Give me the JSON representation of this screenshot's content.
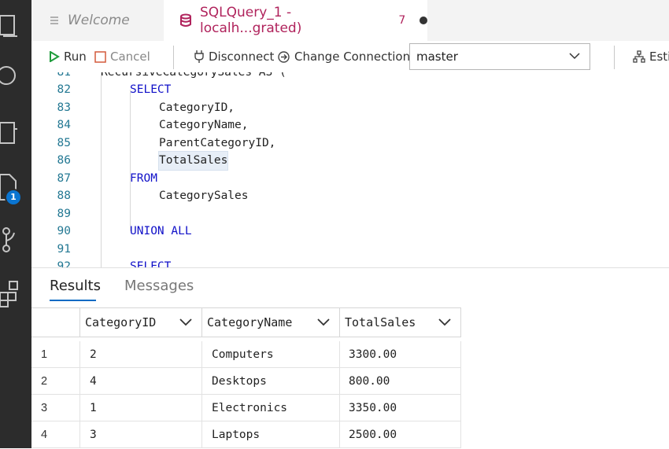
{
  "tabs": {
    "welcome": "Welcome",
    "query": {
      "title": "SQLQuery_1 - localh...grated)",
      "count": "7"
    }
  },
  "toolbar": {
    "run": "Run",
    "cancel": "Cancel",
    "disconnect": "Disconnect",
    "change_connection": "Change Connection",
    "database": "master",
    "estimate": "Esti"
  },
  "activity_bar": {
    "icons": [
      "explorer-icon",
      "search-icon",
      "notebooks-icon",
      "queries-icon",
      "source-control-icon",
      "extensions-icon"
    ],
    "badge": "1"
  },
  "editor": {
    "lines": [
      {
        "num": "81",
        "text": "RecursiveCategorySales AS ("
      },
      {
        "num": "82",
        "text": "SELECT"
      },
      {
        "num": "83",
        "text": "CategoryID,"
      },
      {
        "num": "84",
        "text": "CategoryName,"
      },
      {
        "num": "85",
        "text": "ParentCategoryID,"
      },
      {
        "num": "86",
        "text": "TotalSales"
      },
      {
        "num": "87",
        "text": "FROM"
      },
      {
        "num": "88",
        "text": "CategorySales"
      },
      {
        "num": "89",
        "text": ""
      },
      {
        "num": "90",
        "text": "UNION ALL"
      },
      {
        "num": "91",
        "text": ""
      },
      {
        "num": "92",
        "text": "SELECT"
      }
    ]
  },
  "results": {
    "tabs": [
      "Results",
      "Messages"
    ],
    "columns": [
      "CategoryID",
      "CategoryName",
      "TotalSales"
    ],
    "rows": [
      {
        "n": "1",
        "id": "2",
        "name": "Computers",
        "sales": "3300.00"
      },
      {
        "n": "2",
        "id": "4",
        "name": "Desktops",
        "sales": "800.00"
      },
      {
        "n": "3",
        "id": "1",
        "name": "Electronics",
        "sales": "3350.00"
      },
      {
        "n": "4",
        "id": "3",
        "name": "Laptops",
        "sales": "2500.00"
      }
    ]
  },
  "colors": {
    "accent": "#0a6bc4",
    "tab_text": "#b0235c",
    "keyword": "#1010c8",
    "line_number": "#237893",
    "run_icon": "#1f9c3c",
    "cancel_icon": "#d45a3c"
  }
}
